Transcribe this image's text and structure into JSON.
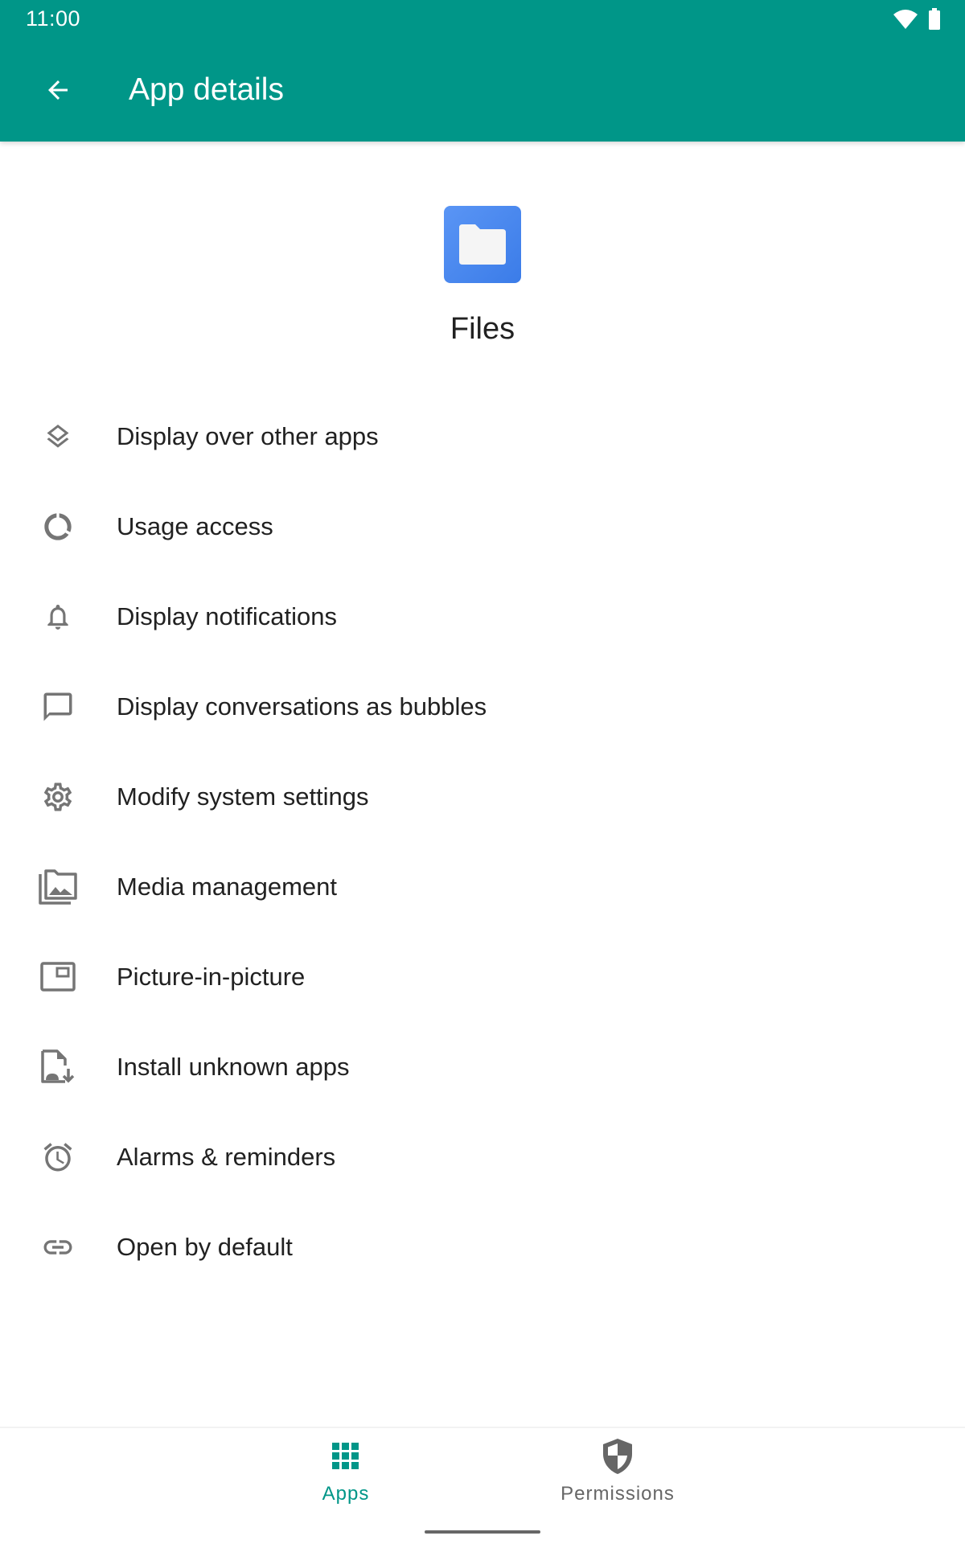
{
  "status_bar": {
    "time": "11:00",
    "icons": [
      "wifi-icon",
      "battery-icon"
    ]
  },
  "app_bar": {
    "back_icon": "arrow-back-icon",
    "title": "App details"
  },
  "app": {
    "name": "Files",
    "icon": "files-folder-icon"
  },
  "list": {
    "items": [
      {
        "label": "Display over other apps",
        "icon": "layers-icon"
      },
      {
        "label": "Usage access",
        "icon": "data-usage-icon"
      },
      {
        "label": "Display notifications",
        "icon": "bell-icon"
      },
      {
        "label": "Display conversations as bubbles",
        "icon": "chat-bubble-icon"
      },
      {
        "label": "Modify system settings",
        "icon": "gear-icon"
      },
      {
        "label": "Media management",
        "icon": "photo-library-icon"
      },
      {
        "label": "Picture-in-picture",
        "icon": "picture-in-picture-icon"
      },
      {
        "label": "Install unknown apps",
        "icon": "install-apk-icon"
      },
      {
        "label": "Alarms & reminders",
        "icon": "alarm-icon"
      },
      {
        "label": "Open by default",
        "icon": "link-icon"
      }
    ]
  },
  "bottom_nav": {
    "items": [
      {
        "label": "Apps",
        "icon": "apps-grid-icon",
        "active": true
      },
      {
        "label": "Permissions",
        "icon": "shield-icon",
        "active": false
      }
    ]
  },
  "colors": {
    "accent": "#009688",
    "icon_gray": "#757575",
    "text": "#212121",
    "app_icon_blue": "#4285f4"
  }
}
